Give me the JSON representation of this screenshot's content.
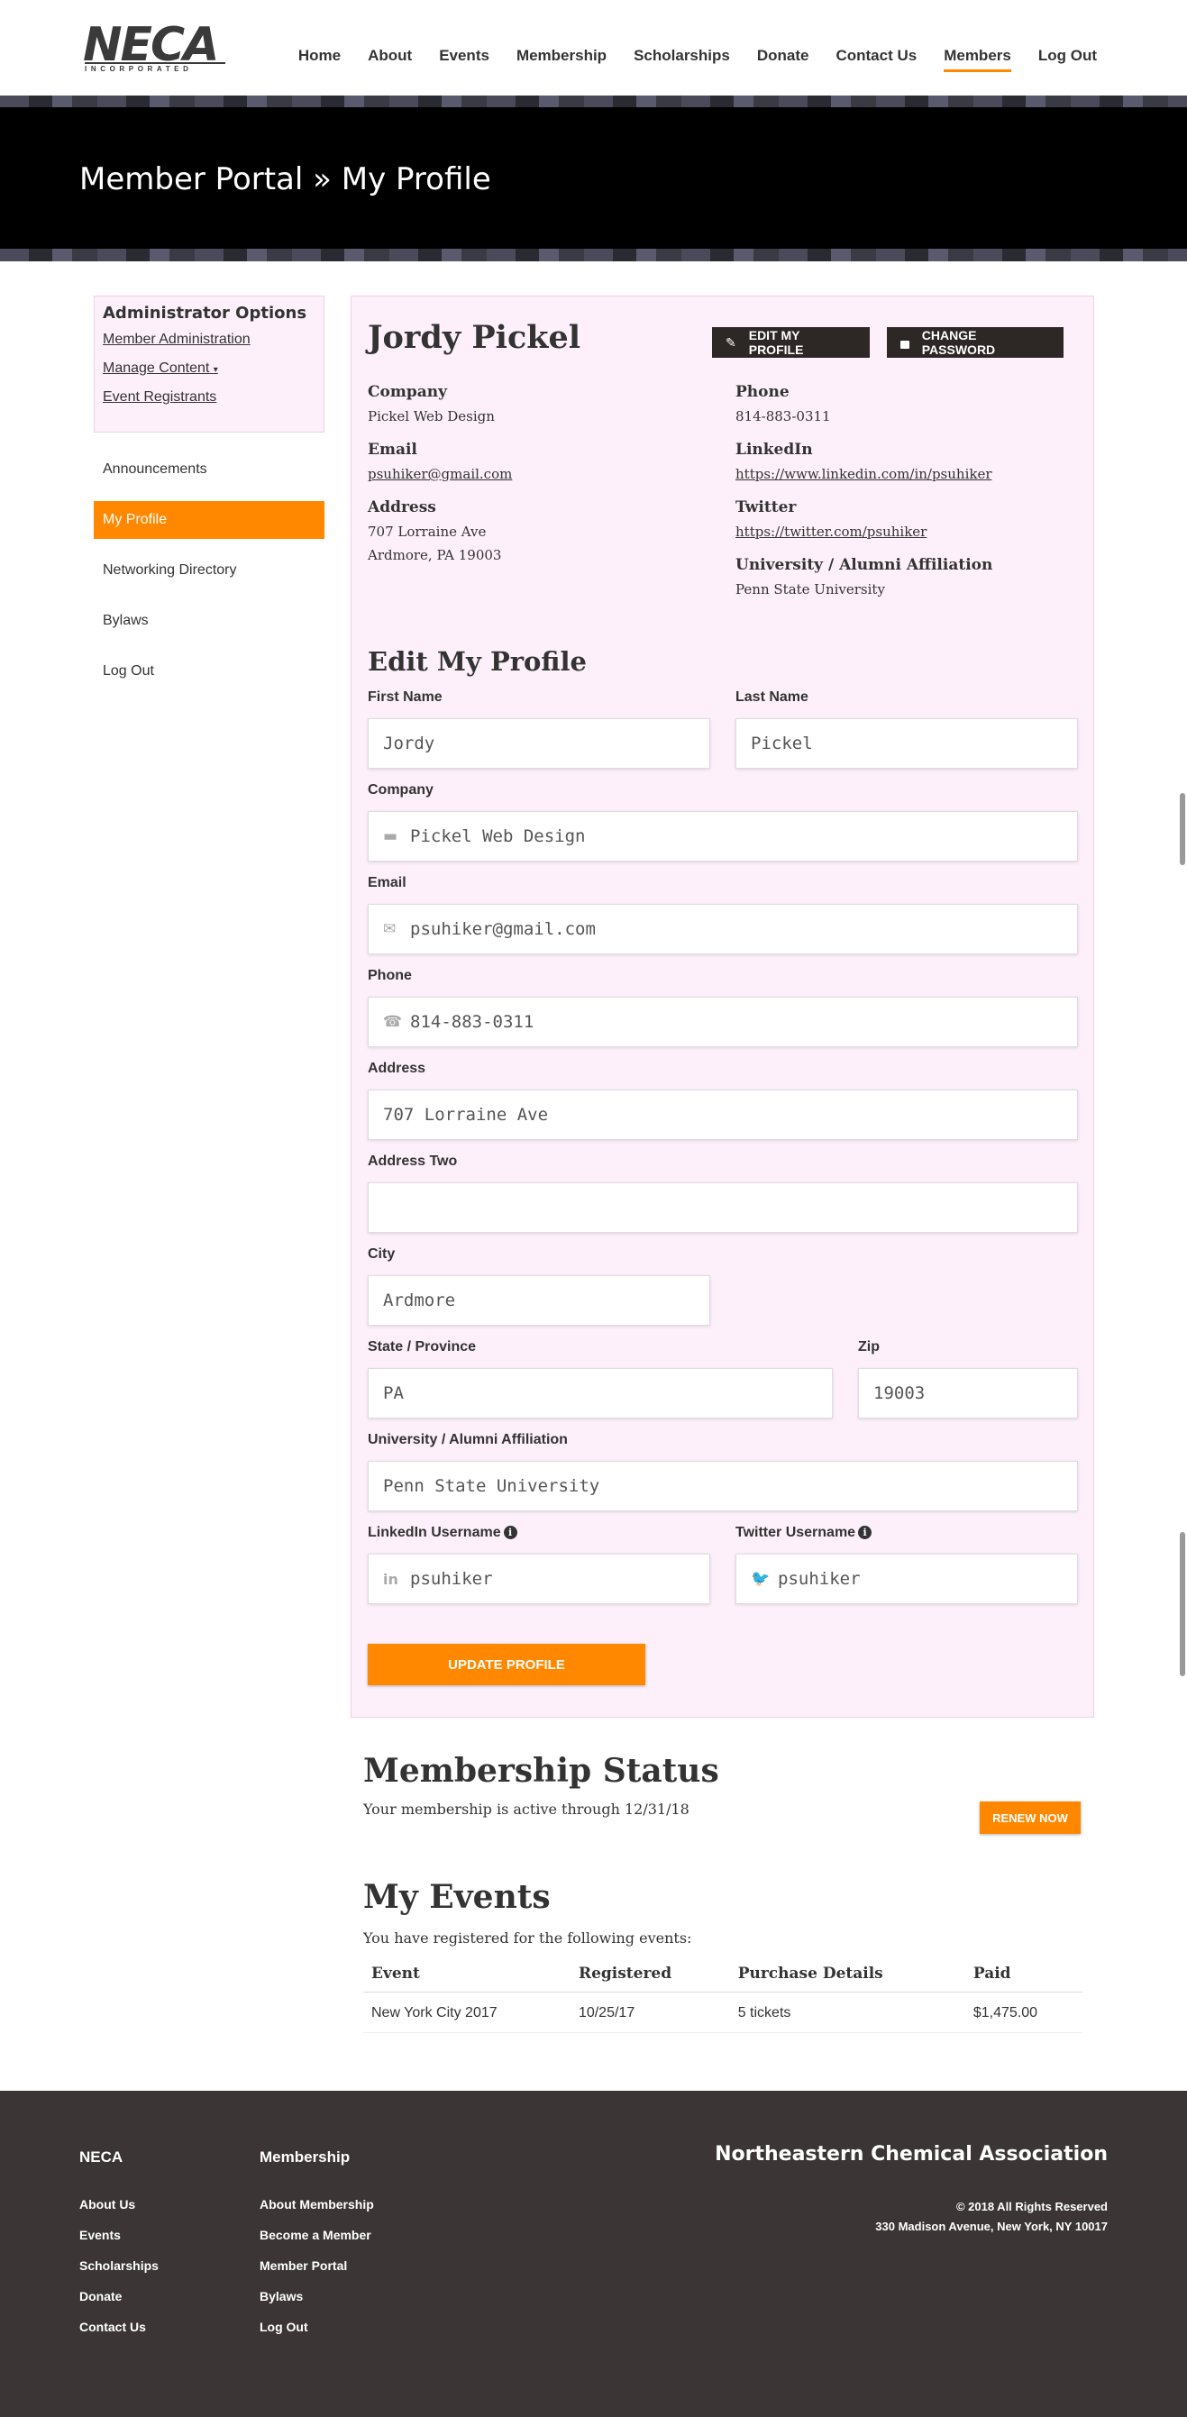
{
  "brand": {
    "logo_text": "NECA",
    "logo_sub": "INCORPORATED"
  },
  "nav": {
    "items": [
      {
        "label": "Home"
      },
      {
        "label": "About"
      },
      {
        "label": "Events"
      },
      {
        "label": "Membership"
      },
      {
        "label": "Scholarships"
      },
      {
        "label": "Donate"
      },
      {
        "label": "Contact Us"
      },
      {
        "label": "Members",
        "active": true
      },
      {
        "label": "Log Out"
      }
    ]
  },
  "banner": {
    "title": "Member Portal » My Profile"
  },
  "admin": {
    "title": "Administrator Options",
    "links": [
      "Member Administration",
      "Manage Content",
      "Event Registrants"
    ]
  },
  "sidebar": {
    "items": [
      {
        "label": "Announcements"
      },
      {
        "label": "My Profile",
        "active": true
      },
      {
        "label": "Networking Directory"
      },
      {
        "label": "Bylaws"
      },
      {
        "label": "Log Out"
      }
    ]
  },
  "profile": {
    "name": "Jordy Pickel",
    "edit_button": "EDIT MY PROFILE",
    "password_button": "CHANGE PASSWORD",
    "company_label": "Company",
    "company": "Pickel Web Design",
    "email_label": "Email",
    "email": "psuhiker@gmail.com",
    "address_label": "Address",
    "address_line1": "707 Lorraine Ave",
    "address_line2": "Ardmore, PA 19003",
    "phone_label": "Phone",
    "phone": "814-883-0311",
    "linkedin_label": "LinkedIn",
    "linkedin": "https://www.linkedin.com/in/psuhiker",
    "twitter_label": "Twitter",
    "twitter": "https://twitter.com/psuhiker",
    "university_label": "University / Alumni Affiliation",
    "university": "Penn State University"
  },
  "form": {
    "title": "Edit My Profile",
    "first_name_label": "First Name",
    "first_name": "Jordy",
    "last_name_label": "Last Name",
    "last_name": "Pickel",
    "company_label": "Company",
    "company": "Pickel Web Design",
    "email_label": "Email",
    "email": "psuhiker@gmail.com",
    "phone_label": "Phone",
    "phone": "814-883-0311",
    "address_label": "Address",
    "address": "707 Lorraine Ave",
    "address_two_label": "Address Two",
    "address_two": "",
    "city_label": "City",
    "city": "Ardmore",
    "state_label": "State / Province",
    "state": "PA",
    "zip_label": "Zip",
    "zip": "19003",
    "university_label": "University / Alumni Affiliation",
    "university": "Penn State University",
    "linkedin_label": "LinkedIn Username",
    "linkedin": "psuhiker",
    "twitter_label": "Twitter Username",
    "twitter": "psuhiker",
    "submit_label": "UPDATE PROFILE"
  },
  "membership": {
    "title": "Membership Status",
    "text": "Your membership is active through 12/31/18",
    "renew_label": "RENEW NOW"
  },
  "events": {
    "title": "My Events",
    "intro": "You have registered for the following events:",
    "headers": [
      "Event",
      "Registered",
      "Purchase Details",
      "Paid"
    ],
    "rows": [
      [
        "New York City 2017",
        "10/25/17",
        "5 tickets",
        "$1,475.00"
      ]
    ]
  },
  "footer": {
    "col1_title": "NECA",
    "col1_links": [
      "About Us",
      "Events",
      "Scholarships",
      "Donate",
      "Contact Us"
    ],
    "col2_title": "Membership",
    "col2_links": [
      "About Membership",
      "Become a Member",
      "Member Portal",
      "Bylaws",
      "Log Out"
    ],
    "org_name": "Northeastern Chemical Association",
    "copyright": "© 2018 All Rights Reserved",
    "address": "330 Madison Avenue, New York, NY 10017"
  },
  "colors": {
    "accent": "#ff8800",
    "dark": "#2d2726",
    "panel_bg": "#fdf0fa",
    "footer_bg": "#3b3535"
  }
}
